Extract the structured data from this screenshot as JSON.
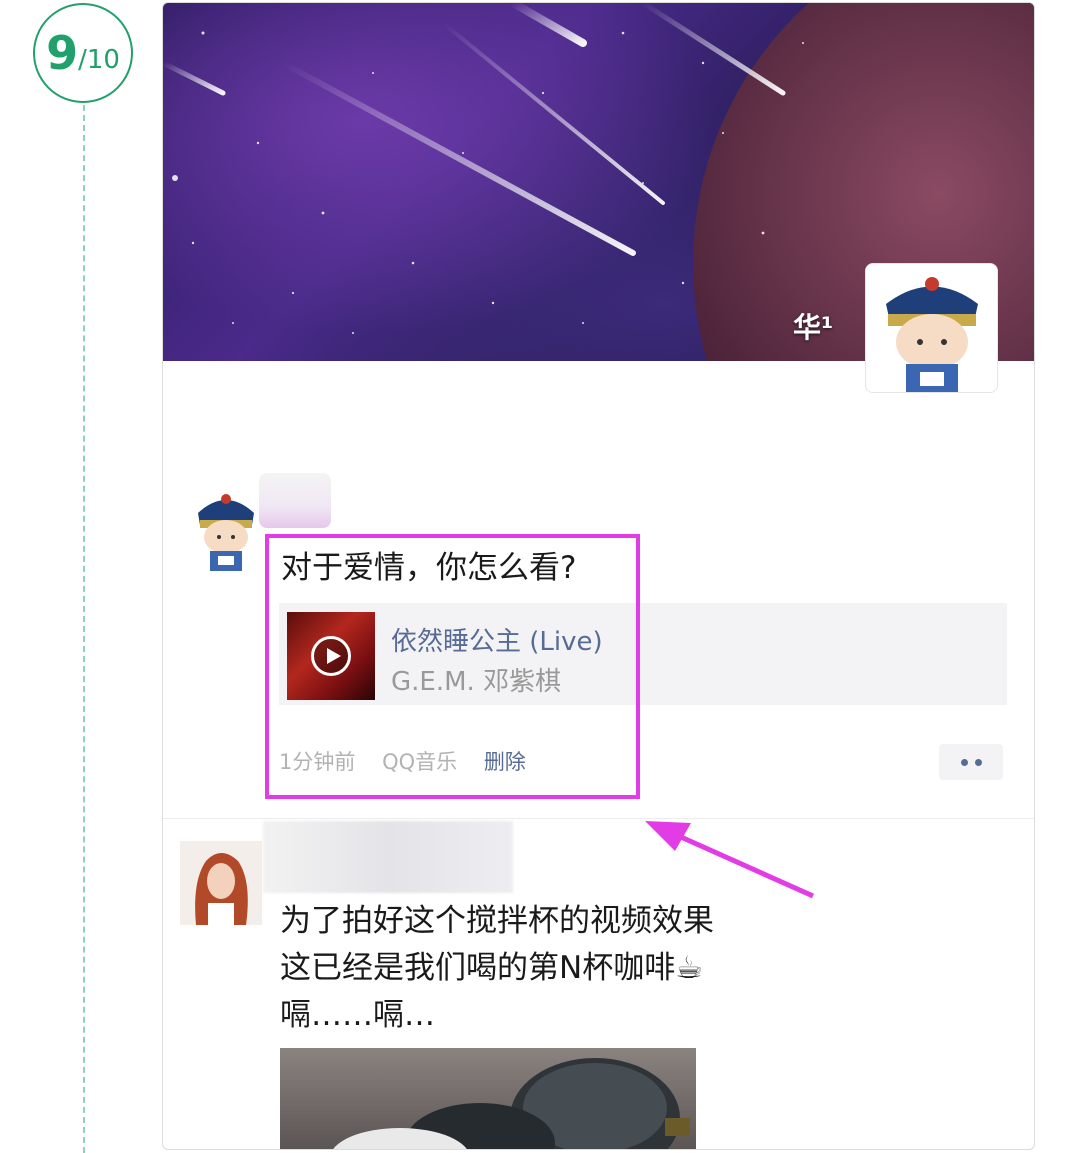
{
  "step": {
    "current": "9",
    "total": "/10"
  },
  "colors": {
    "step_green": "#22a06b",
    "highlight": "#e23ce6",
    "link_blue": "#576b95",
    "meta_gray": "#b2b2b2"
  },
  "cover": {
    "name": "华¹"
  },
  "post1": {
    "text": "对于爱情，你怎么看?",
    "music": {
      "title": "依然睡公主 (Live)",
      "artist": "G.E.M. 邓紫棋",
      "icon": "play-icon"
    },
    "meta": {
      "time": "1分钟前",
      "source": "QQ音乐",
      "delete": "删除"
    }
  },
  "post2": {
    "text": "为了拍好这个搅拌杯的视频效果\n这已经是我们喝的第N杯咖啡☕\n嗝……嗝…"
  }
}
